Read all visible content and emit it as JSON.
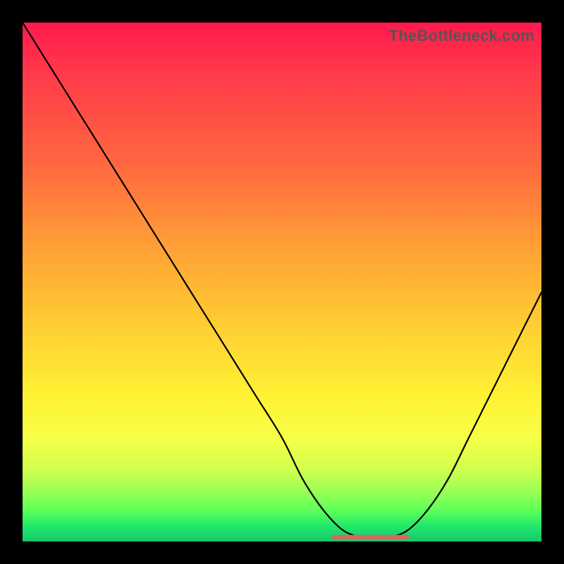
{
  "watermark": "TheBottleneck.com",
  "colors": {
    "accent_flat": "#d26a62",
    "curve": "#000000"
  },
  "chart_data": {
    "type": "line",
    "title": "",
    "xlabel": "",
    "ylabel": "",
    "xlim": [
      0,
      100
    ],
    "ylim": [
      0,
      100
    ],
    "grid": false,
    "legend": false,
    "series": [
      {
        "name": "bottleneck-curve",
        "x": [
          0,
          5,
          10,
          15,
          20,
          25,
          30,
          35,
          40,
          45,
          50,
          54,
          58,
          62,
          66,
          70,
          74,
          78,
          82,
          86,
          90,
          94,
          100
        ],
        "y": [
          100,
          92,
          84,
          76,
          68,
          60,
          52,
          44,
          36,
          28,
          20,
          12,
          6,
          2,
          0.8,
          0.8,
          2,
          6,
          12,
          20,
          28,
          36,
          48
        ],
        "note": "V-shaped curve. Flat minimum around x≈62–72 near y≈0. Left arm starts at top-left (100%), right arm rises to ~48% at x=100. Values are approximate, read from gradient proportions."
      }
    ],
    "annotations": [
      {
        "name": "flat-bottom-marker",
        "x_range": [
          60,
          74
        ],
        "y": 0.8,
        "color": "#d26a62",
        "description": "Short reddish horizontal segment highlighting the flat minimum of the curve"
      }
    ]
  }
}
